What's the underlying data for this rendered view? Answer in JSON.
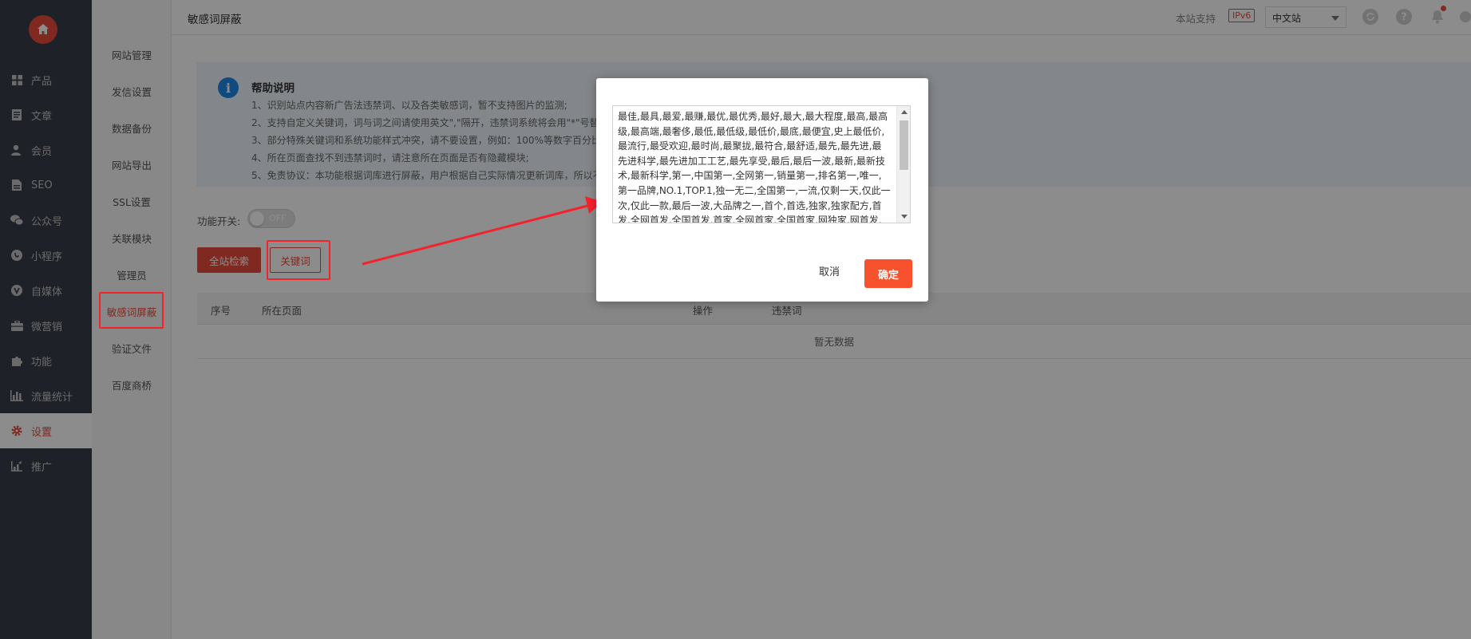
{
  "nav": {
    "items": [
      {
        "label": "产品",
        "icon": "grid-icon"
      },
      {
        "label": "文章",
        "icon": "document-icon"
      },
      {
        "label": "会员",
        "icon": "user-icon"
      },
      {
        "label": "SEO",
        "icon": "seo-file-icon"
      },
      {
        "label": "公众号",
        "icon": "wechat-icon"
      },
      {
        "label": "小程序",
        "icon": "miniprogram-icon"
      },
      {
        "label": "自媒体",
        "icon": "media-icon"
      },
      {
        "label": "微营销",
        "icon": "marketing-icon"
      },
      {
        "label": "功能",
        "icon": "puzzle-icon"
      },
      {
        "label": "流量统计",
        "icon": "bar-chart-icon"
      },
      {
        "label": "设置",
        "icon": "gear-icon"
      },
      {
        "label": "推广",
        "icon": "promotion-icon"
      }
    ]
  },
  "submenu": {
    "items": [
      "网站管理",
      "发信设置",
      "数据备份",
      "网站导出",
      "SSL设置",
      "关联模块",
      "管理员",
      "敏感词屏蔽",
      "验证文件",
      "百度商桥"
    ]
  },
  "header": {
    "title": "敏感词屏蔽",
    "support_label": "本站支持",
    "ipv6_badge": "IPv6",
    "site_select": "中文站"
  },
  "help": {
    "title": "帮助说明",
    "lines": [
      "1、识别站点内容新广告法违禁词、以及各类敏感词，暂不支持图片的监测;",
      "2、支持自定义关键词，词与词之间请使用英文\",\"隔开，违禁词系统将会用\"*\"号替",
      "3、部分特殊关键词和系统功能样式冲突，请不要设置，例如：100%等数字百分比",
      "4、所在页面查找不到违禁词时，请注意所在页面是否有隐藏模块;",
      "5、免责协议：本功能根据词库进行屏蔽，用户根据自己实际情况更新词库，所以不"
    ]
  },
  "switch": {
    "label": "功能开关:",
    "state": "OFF"
  },
  "buttons": {
    "scan": "全站检索",
    "keywords": "关键词"
  },
  "table": {
    "columns": [
      "序号",
      "所在页面",
      "操作",
      "违禁词"
    ],
    "empty": "暂无数据"
  },
  "modal": {
    "keywords": "最佳,最具,最爱,最赚,最优,最优秀,最好,最大,最大程度,最高,最高级,最高端,最奢侈,最低,最低级,最低价,最底,最便宜,史上最低价,最流行,最受欢迎,最时尚,最聚拢,最符合,最舒适,最先,最先进,最先进科学,最先进加工工艺,最先享受,最后,最后一波,最新,最新技术,最新科学,第一,中国第一,全网第一,销量第一,排名第一,唯一,第一品牌,NO.1,TOP.1,独一无二,全国第一,一流,仅剩一天,仅此一次,仅此一款,最后一波,大品牌之一,首个,首选,独家,独家配方,首发,全网首发,全国首发,首家,全网首家,全国首家,网独家,网首发,首次,首款,全",
    "cancel": "取消",
    "confirm": "确定"
  },
  "colors": {
    "accent": "#e74c3c",
    "sidebar": "#393d49",
    "help_bg": "#eef5fb",
    "highlight": "#f5222d"
  }
}
